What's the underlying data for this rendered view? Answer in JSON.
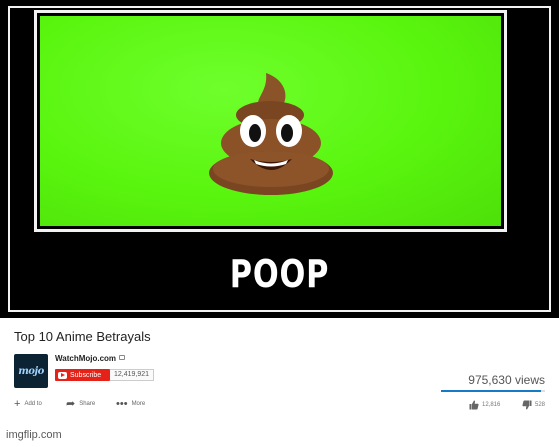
{
  "meme": {
    "caption": "POOP",
    "emoji": "pile-of-poo",
    "background_color": "#59f50e"
  },
  "video": {
    "title": "Top 10 Anime Betrayals",
    "channel": {
      "name": "WatchMojo.com",
      "logo_text": "mojo"
    },
    "subscribe_label": "Subscribe",
    "subscriber_count": "12,419,921",
    "views": "975,630 views",
    "like_ratio": 0.96,
    "actions": {
      "add_to": "Add to",
      "share": "Share",
      "more": "More"
    },
    "likes": "12,816",
    "dislikes": "528"
  },
  "watermark": "imgflip.com",
  "colors": {
    "accent": "#e62117",
    "link_blue": "#167ac6"
  }
}
